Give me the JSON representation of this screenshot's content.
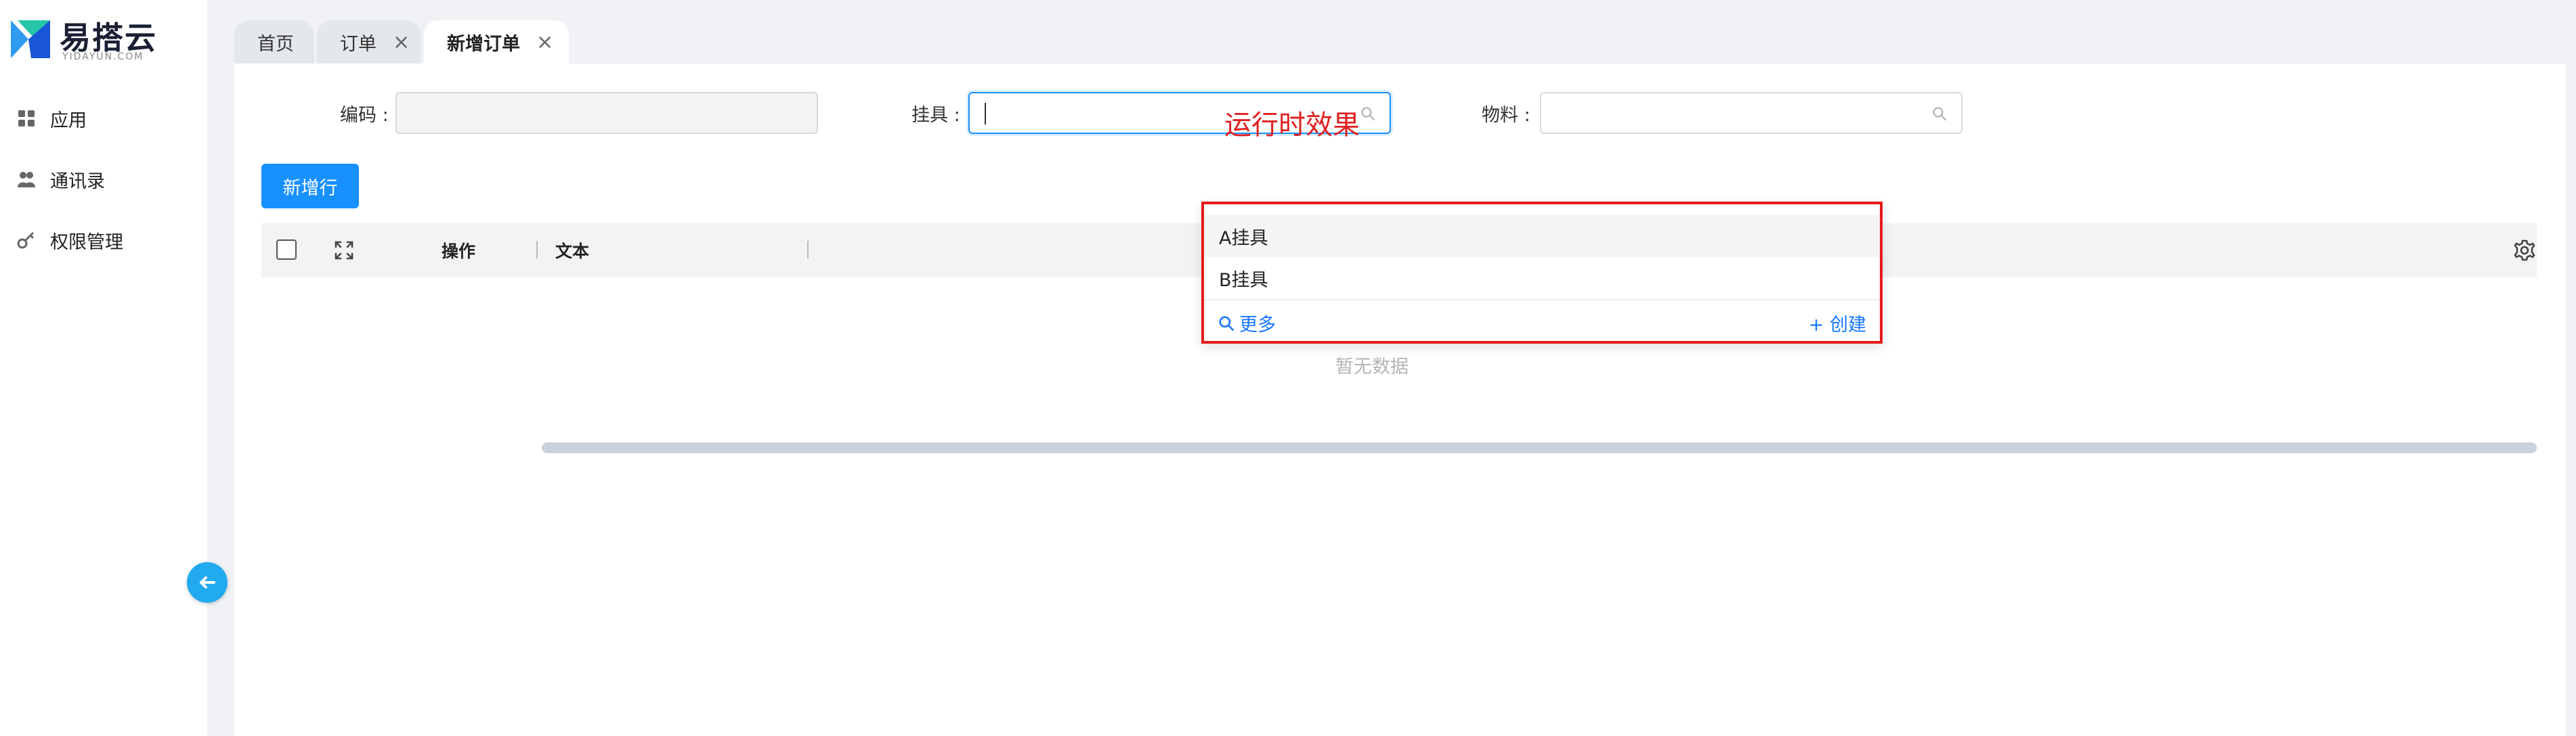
{
  "brand": {
    "name": "易搭云",
    "sub": "YIDAYUN.COM",
    "accent": "#1890ff"
  },
  "sidebar": {
    "items": [
      {
        "label": "应用",
        "icon": "apps-icon"
      },
      {
        "label": "通讯录",
        "icon": "contacts-icon"
      },
      {
        "label": "权限管理",
        "icon": "key-icon"
      }
    ]
  },
  "tabs": [
    {
      "label": "首页",
      "closable": false,
      "active": false
    },
    {
      "label": "订单",
      "closable": true,
      "active": false
    },
    {
      "label": "新增订单",
      "closable": true,
      "active": true
    }
  ],
  "form": {
    "code_label": "编码 :",
    "code_value": "",
    "fixture_label": "挂具 :",
    "fixture_value": "",
    "material_label": "物料 :",
    "material_value": ""
  },
  "toolbar": {
    "add_row_label": "新增行"
  },
  "table": {
    "columns": [
      "操作",
      "文本"
    ],
    "empty_text": "暂无数据"
  },
  "dropdown": {
    "note": "运行时效果",
    "options": [
      "A挂具",
      "B挂具"
    ],
    "more_label": "更多",
    "create_label": "+ 创建",
    "highlight_color": "#e51b1b"
  }
}
